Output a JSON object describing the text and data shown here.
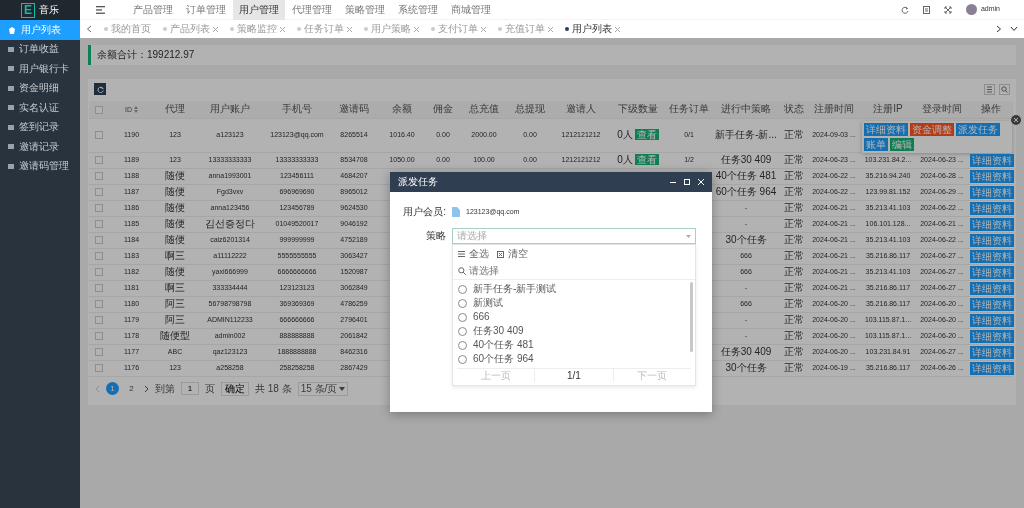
{
  "sidebar": {
    "logo_mark": "E",
    "logo": "音乐",
    "items": [
      {
        "label": "用户列表",
        "selected": true
      },
      {
        "label": "订单收益",
        "selected": false
      },
      {
        "label": "用户银行卡",
        "selected": false
      },
      {
        "label": "资金明细",
        "selected": false
      },
      {
        "label": "实名认证",
        "selected": false
      },
      {
        "label": "签到记录",
        "selected": false
      },
      {
        "label": "邀请记录",
        "selected": false
      },
      {
        "label": "邀请码管理",
        "selected": false
      }
    ]
  },
  "top_nav": {
    "items": [
      {
        "label": "产品管理",
        "selected": false
      },
      {
        "label": "订单管理",
        "selected": false
      },
      {
        "label": "用户管理",
        "selected": true
      },
      {
        "label": "代理管理",
        "selected": false
      },
      {
        "label": "策略管理",
        "selected": false
      },
      {
        "label": "系统管理",
        "selected": false
      },
      {
        "label": "商城管理",
        "selected": false
      }
    ],
    "user": "admin"
  },
  "tabs": [
    {
      "label": "我的首页",
      "closable": false,
      "selected": false
    },
    {
      "label": "产品列表",
      "closable": true,
      "selected": false
    },
    {
      "label": "策略监控",
      "closable": true,
      "selected": false
    },
    {
      "label": "任务订单",
      "closable": true,
      "selected": false
    },
    {
      "label": "用户策略",
      "closable": true,
      "selected": false
    },
    {
      "label": "支付订单",
      "closable": true,
      "selected": false
    },
    {
      "label": "充值订单",
      "closable": true,
      "selected": false
    },
    {
      "label": "用户列表",
      "closable": true,
      "selected": true
    }
  ],
  "summary": "余额合计：199212.97",
  "table": {
    "header_checked": false,
    "columns": [
      "ID",
      "代理",
      "用户账户",
      "手机号",
      "邀请码",
      "余额",
      "佣金",
      "总充值",
      "总提现",
      "邀请人",
      "下级数量",
      "任务订单",
      "进行中策略",
      "状态",
      "注册时间",
      "注册IP",
      "登录时间",
      "操作"
    ],
    "rows": [
      {
        "checked": false,
        "id": "1190",
        "agent": "123",
        "account": "a123123",
        "phone": "123123@qq.com",
        "invite_code": "8265514",
        "balance": "1016.40",
        "commission": "0.00",
        "total_recharge": "2000.00",
        "total_withdraw": "0.00",
        "inviter": "1212121212",
        "subordinates": "0人",
        "subordinates_badge": "查看",
        "task_orders": "0/1",
        "active_strategy": "新手任务-新...",
        "status": "正常",
        "register_time": "2024-09-03 ...",
        "actions_expanded": true,
        "actions": [
          {
            "label": "详细资料",
            "kind": "info"
          },
          {
            "label": "资金调整",
            "kind": "warn"
          },
          {
            "label": "派发任务",
            "kind": "info"
          },
          {
            "label": "账单",
            "kind": "info"
          },
          {
            "label": "编辑",
            "kind": "success"
          }
        ]
      },
      {
        "checked": false,
        "id": "1189",
        "agent": "123",
        "account": "13333333333",
        "phone": "13333333333",
        "invite_code": "8534708",
        "balance": "1050.00",
        "commission": "0.00",
        "total_recharge": "100.00",
        "total_withdraw": "0.00",
        "inviter": "1212121212",
        "subordinates": "0人",
        "subordinates_badge": "查看",
        "task_orders": "1/2",
        "active_strategy": "任务30 409",
        "status": "正常",
        "register_time": "2024-06-23 ...",
        "register_ip": "103.231.84.2...",
        "login_time": "2024-06-23 ...",
        "actions_expanded": false,
        "actions": [
          {
            "label": "详细资料",
            "kind": "info"
          }
        ]
      },
      {
        "checked": false,
        "id": "1188",
        "agent": "随便",
        "account": "anna1993001",
        "phone": "123456111",
        "invite_code": "4684207",
        "active_strategy": "40个任务 481",
        "status": "正常",
        "register_time": "2024-06-22 ...",
        "register_ip": "35.216.94.240",
        "login_time": "2024-06-28 ...",
        "actions_expanded": false,
        "actions": [
          {
            "label": "详细资料",
            "kind": "info"
          }
        ]
      },
      {
        "checked": false,
        "id": "1187",
        "agent": "随便",
        "account": "Fgd3vxv",
        "phone": "696969690",
        "invite_code": "8965012",
        "active_strategy": "60个任务 964",
        "status": "正常",
        "register_time": "2024-06-22 ...",
        "register_ip": "123.99.81.152",
        "login_time": "2024-06-29 ...",
        "actions_expanded": false,
        "actions": [
          {
            "label": "详细资料",
            "kind": "info"
          }
        ]
      },
      {
        "checked": false,
        "id": "1186",
        "agent": "随便",
        "account": "anna123456",
        "phone": "123456789",
        "invite_code": "9624530",
        "active_strategy": "-",
        "status": "正常",
        "register_time": "2024-06-21 ...",
        "register_ip": "35.213.41.103",
        "login_time": "2024-06-22 ...",
        "actions_expanded": false,
        "actions": [
          {
            "label": "详细资料",
            "kind": "info"
          }
        ]
      },
      {
        "checked": false,
        "id": "1185",
        "agent": "随便",
        "account": "김선증정다",
        "phone": "01049520017",
        "invite_code": "9046192",
        "active_strategy": "-",
        "status": "正常",
        "register_time": "2024-06-21 ...",
        "register_ip": "106.101.128...",
        "login_time": "2024-06-21 ...",
        "actions_expanded": false,
        "actions": [
          {
            "label": "详细资料",
            "kind": "info"
          }
        ]
      },
      {
        "checked": false,
        "id": "1184",
        "agent": "随便",
        "account": "caiz6201314",
        "phone": "999999999",
        "invite_code": "4752189",
        "active_strategy": "30个任务",
        "status": "正常",
        "register_time": "2024-06-21 ...",
        "register_ip": "35.213.41.103",
        "login_time": "2024-06-22 ...",
        "actions_expanded": false,
        "actions": [
          {
            "label": "详细资料",
            "kind": "info"
          }
        ]
      },
      {
        "checked": false,
        "id": "1183",
        "agent": "啊三",
        "account": "a11112222",
        "phone": "5555555555",
        "invite_code": "3063427",
        "active_strategy": "666",
        "status": "正常",
        "register_time": "2024-06-21 ...",
        "register_ip": "35.216.86.117",
        "login_time": "2024-06-27 ...",
        "actions_expanded": false,
        "actions": [
          {
            "label": "详细资料",
            "kind": "info"
          }
        ]
      },
      {
        "checked": false,
        "id": "1182",
        "agent": "随便",
        "account": "yaxi666999",
        "phone": "6666666666",
        "invite_code": "1520987",
        "active_strategy": "666",
        "status": "正常",
        "register_time": "2024-06-21 ...",
        "register_ip": "35.213.41.103",
        "login_time": "2024-06-27 ...",
        "actions_expanded": false,
        "actions": [
          {
            "label": "详细资料",
            "kind": "info"
          }
        ]
      },
      {
        "checked": false,
        "id": "1181",
        "agent": "啊三",
        "account": "333334444",
        "phone": "123123123",
        "invite_code": "3062849",
        "active_strategy": "-",
        "status": "正常",
        "register_time": "2024-06-21 ...",
        "register_ip": "35.216.86.117",
        "login_time": "2024-06-27 ...",
        "actions_expanded": false,
        "actions": [
          {
            "label": "详细资料",
            "kind": "info"
          }
        ]
      },
      {
        "checked": false,
        "id": "1180",
        "agent": "阿三",
        "account": "56798798798",
        "phone": "369369369",
        "invite_code": "4786259",
        "active_strategy": "666",
        "status": "正常",
        "register_time": "2024-06-20 ...",
        "register_ip": "35.216.86.117",
        "login_time": "2024-06-20 ...",
        "actions_expanded": false,
        "actions": [
          {
            "label": "详细资料",
            "kind": "info"
          }
        ]
      },
      {
        "checked": false,
        "id": "1179",
        "agent": "阿三",
        "account": "ADMIN112233",
        "phone": "666666666",
        "invite_code": "2796401",
        "active_strategy": "-",
        "status": "正常",
        "register_time": "2024-06-20 ...",
        "register_ip": "103.115.87.1...",
        "login_time": "2024-06-20 ...",
        "actions_expanded": false,
        "actions": [
          {
            "label": "详细资料",
            "kind": "info"
          }
        ]
      },
      {
        "checked": false,
        "id": "1178",
        "agent": "随便型",
        "account": "admin002",
        "phone": "888888888",
        "invite_code": "2061842",
        "active_strategy": "-",
        "status": "正常",
        "register_time": "2024-06-20 ...",
        "register_ip": "103.115.87.1...",
        "login_time": "2024-06-20 ...",
        "actions_expanded": false,
        "actions": [
          {
            "label": "详细资料",
            "kind": "info"
          }
        ]
      },
      {
        "checked": false,
        "id": "1177",
        "agent": "ABC",
        "account": "qaz123123",
        "phone": "1888888888",
        "invite_code": "8462316",
        "active_strategy": "任务30 409",
        "status": "正常",
        "register_time": "2024-06-20 ...",
        "register_ip": "103.231.84.91",
        "login_time": "2024-06-27 ...",
        "actions_expanded": false,
        "actions": [
          {
            "label": "详细资料",
            "kind": "info"
          }
        ]
      },
      {
        "checked": false,
        "id": "1176",
        "agent": "123",
        "account": "a258258",
        "phone": "258258258",
        "invite_code": "2867429",
        "active_strategy": "30个任务",
        "status": "正常",
        "register_time": "2024-06-19 ...",
        "register_ip": "35.216.86.117",
        "login_time": "2024-06-26 ...",
        "actions_expanded": false,
        "actions": [
          {
            "label": "详细资料",
            "kind": "info"
          }
        ]
      }
    ]
  },
  "pagination": {
    "pages": [
      {
        "label": "1",
        "selected": true
      },
      {
        "label": "2",
        "selected": false
      }
    ],
    "goto_label": "到第",
    "goto_value": "1",
    "page_unit": "页",
    "confirm": "确定",
    "total": "共 18 条",
    "page_size": "15 条/页"
  },
  "modal": {
    "title": "派发任务",
    "member_label": "用户会员:",
    "member_value": "123123@qq.com",
    "strategy_label": "策略",
    "select_placeholder": "请选择",
    "select_all": "全选",
    "clear": "清空",
    "search_placeholder": "请选择",
    "options": [
      {
        "label": "新手任务-新手测试",
        "selected": false
      },
      {
        "label": "新测试",
        "selected": false
      },
      {
        "label": "666",
        "selected": false
      },
      {
        "label": "任务30 409",
        "selected": false
      },
      {
        "label": "40个任务 481",
        "selected": false
      },
      {
        "label": "60个任务 964",
        "selected": false
      }
    ],
    "pager": {
      "prev": {
        "label": "上一页",
        "disabled": true
      },
      "page": "1/1",
      "next": {
        "label": "下一页",
        "disabled": true
      }
    }
  }
}
